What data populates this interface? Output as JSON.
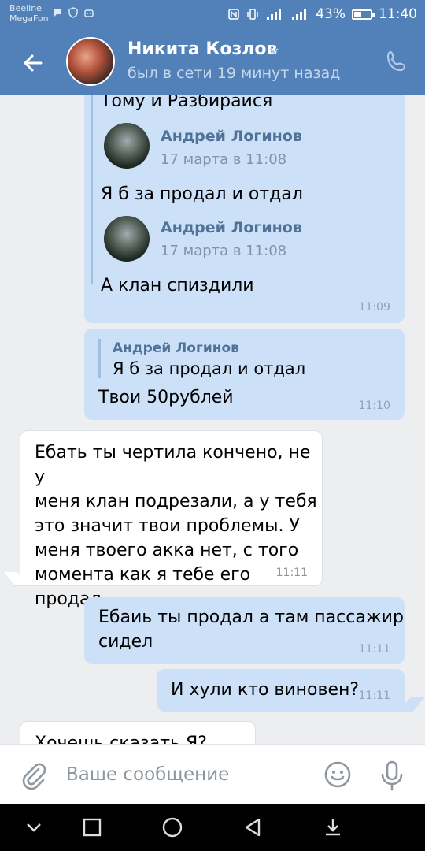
{
  "status_bar": {
    "carrier_1": "Beeline",
    "carrier_2": "MegaFon",
    "battery": "43%",
    "battery_level": 0.43,
    "time": "11:40"
  },
  "header": {
    "contact_name": "Никита Козлов",
    "last_seen": "был в сети 19 минут назад"
  },
  "messages": [
    {
      "direction": "out",
      "partial_text": "Тому и Разбирайся",
      "forwarded": [
        {
          "author": "Андрей Логинов",
          "date": "17 марта в 11:08",
          "text": "Я б за продал и отдал"
        },
        {
          "author": "Андрей Логинов",
          "date": "17 марта в 11:08",
          "text": "А клан спиздили"
        }
      ],
      "time": "11:09"
    },
    {
      "direction": "out",
      "reply": {
        "author": "Андрей Логинов",
        "text": "Я б за продал и отдал"
      },
      "text": "Твои 50рублей",
      "time": "11:10"
    },
    {
      "direction": "in",
      "lines": [
        "Ебать ты чертила кончено, не у",
        "меня клан подрезали, а у тебя",
        "это значит твои проблемы. У",
        "меня твоего акка нет, с того",
        "момента как я тебе его продал"
      ],
      "time": "11:11"
    },
    {
      "direction": "out",
      "lines": [
        "Ебаиь ты продал а там пассажир",
        "сидел"
      ],
      "time": "11:11"
    },
    {
      "direction": "out",
      "text": "И хули кто виновен?",
      "time": "11:11"
    },
    {
      "direction": "in",
      "text": "Хочешь сказать Я?"
    }
  ],
  "composer": {
    "placeholder": "Ваше сообщение"
  },
  "colors": {
    "header_bg": "#5181b8",
    "outgoing_bubble": "#cce1f7",
    "incoming_bubble": "#ffffff",
    "chat_bg": "#edeef0",
    "author_link": "#507299"
  }
}
